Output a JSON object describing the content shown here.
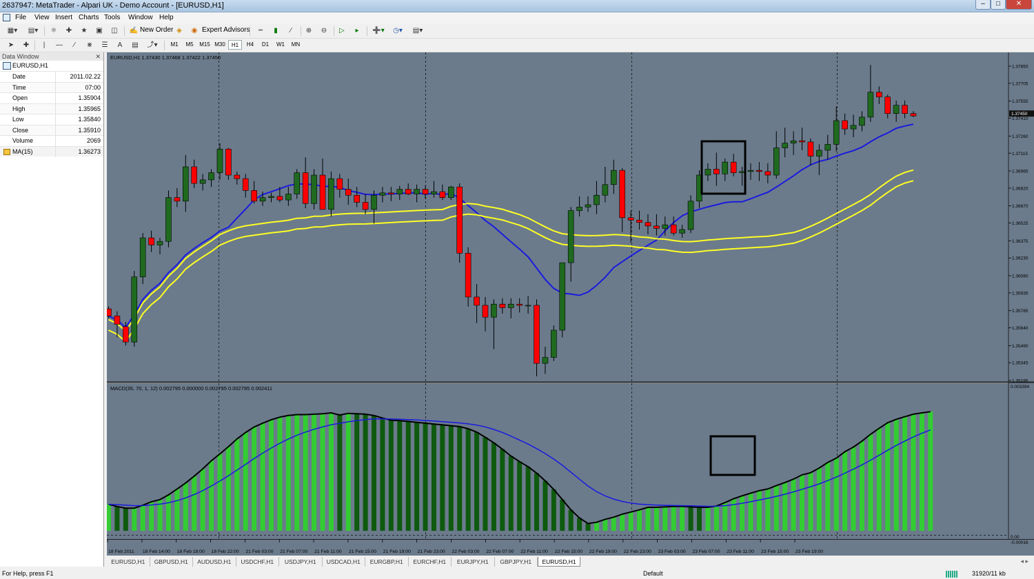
{
  "window": {
    "title": "2637947: MetaTrader - Alpari UK - Demo Account - [EURUSD,H1]"
  },
  "menu": [
    "File",
    "View",
    "Insert",
    "Charts",
    "Tools",
    "Window",
    "Help"
  ],
  "toolbar": {
    "new_order": "New Order",
    "expert_advisors": "Expert Advisors"
  },
  "timeframes": [
    "M1",
    "M5",
    "M15",
    "M30",
    "H1",
    "H4",
    "D1",
    "W1",
    "MN"
  ],
  "active_timeframe": "H1",
  "data_window": {
    "title": "Data Window",
    "symbol": "EURUSD,H1",
    "rows": [
      {
        "label": "Date",
        "value": "2011.02.22"
      },
      {
        "label": "Time",
        "value": "07:00"
      },
      {
        "label": "Open",
        "value": "1.35904"
      },
      {
        "label": "High",
        "value": "1.35965"
      },
      {
        "label": "Low",
        "value": "1.35840"
      },
      {
        "label": "Close",
        "value": "1.35910"
      },
      {
        "label": "Volume",
        "value": "2069"
      },
      {
        "label": "MA(15)",
        "value": "1.36273"
      }
    ]
  },
  "chart": {
    "header": "EURUSD,H1  1.37430 1.37468 1.37422 1.37450",
    "macd_header": "MACD(35, 70, 1, 12) 0.002795 0.000000 0.002795 0.002795 0.002411",
    "price_axis_labels": [
      "1.37850",
      "1.37705",
      "1.37555",
      "1.37410",
      "1.37260",
      "1.37115",
      "1.36965",
      "1.36820",
      "1.36670",
      "1.36525",
      "1.36375",
      "1.36230",
      "1.36080",
      "1.35935",
      "1.35785",
      "1.35640",
      "1.35490",
      "1.35345",
      "1.35195"
    ],
    "current_price": "1.37450",
    "macd_axis_labels": [
      "0.003394",
      "0.00",
      "-0.00016"
    ],
    "time_labels": [
      "18 Feb 2011",
      "18 Feb 14:00",
      "18 Feb 18:00",
      "18 Feb 22:00",
      "21 Feb 03:00",
      "21 Feb 07:00",
      "21 Feb 11:00",
      "21 Feb 15:00",
      "21 Feb 19:00",
      "21 Feb 23:00",
      "22 Feb 03:00",
      "22 Feb 07:00",
      "22 Feb 11:00",
      "22 Feb 15:00",
      "22 Feb 19:00",
      "22 Feb 23:00",
      "23 Feb 03:00",
      "23 Feb 07:00",
      "23 Feb 11:00",
      "23 Feb 15:00",
      "23 Feb 19:00"
    ],
    "colors": {
      "background": "#6b7b8c",
      "bull": "#1f6a1f",
      "bear": "#ff0000",
      "ma_blue": "#1a1adf",
      "ma_yellow": "#ffff22",
      "macd_light": "#33cc33",
      "macd_dark": "#0e5a0e"
    }
  },
  "chart_data": {
    "type": "candlestick",
    "ohlc": [
      [
        1.358,
        1.3582,
        1.3572,
        1.3574
      ],
      [
        1.3574,
        1.3578,
        1.3556,
        1.3567
      ],
      [
        1.3565,
        1.3569,
        1.3549,
        1.3552
      ],
      [
        1.3552,
        1.3612,
        1.3548,
        1.3607
      ],
      [
        1.3607,
        1.3644,
        1.3601,
        1.364
      ],
      [
        1.364,
        1.3646,
        1.3628,
        1.3634
      ],
      [
        1.3634,
        1.364,
        1.3626,
        1.3637
      ],
      [
        1.3637,
        1.368,
        1.3632,
        1.3674
      ],
      [
        1.3674,
        1.3682,
        1.3666,
        1.3671
      ],
      [
        1.3671,
        1.371,
        1.3662,
        1.37
      ],
      [
        1.37,
        1.3706,
        1.3682,
        1.3686
      ],
      [
        1.3686,
        1.3694,
        1.368,
        1.3689
      ],
      [
        1.3689,
        1.3698,
        1.3683,
        1.3695
      ],
      [
        1.3695,
        1.372,
        1.3689,
        1.3715
      ],
      [
        1.3715,
        1.3716,
        1.3689,
        1.3693
      ],
      [
        1.3693,
        1.3696,
        1.3685,
        1.369
      ],
      [
        1.369,
        1.3694,
        1.3674,
        1.368
      ],
      [
        1.368,
        1.3688,
        1.3669,
        1.3671
      ],
      [
        1.3671,
        1.3679,
        1.3667,
        1.3674
      ],
      [
        1.3674,
        1.3678,
        1.367,
        1.3675
      ],
      [
        1.3675,
        1.3683,
        1.367,
        1.3672
      ],
      [
        1.3672,
        1.3683,
        1.3667,
        1.3677
      ],
      [
        1.3677,
        1.3698,
        1.3673,
        1.3695
      ],
      [
        1.3695,
        1.3708,
        1.3665,
        1.3669
      ],
      [
        1.3669,
        1.3698,
        1.3664,
        1.3693
      ],
      [
        1.3693,
        1.3707,
        1.3682,
        1.3664
      ],
      [
        1.3664,
        1.3696,
        1.3658,
        1.369
      ],
      [
        1.369,
        1.3694,
        1.3674,
        1.3681
      ],
      [
        1.3681,
        1.369,
        1.3668,
        1.3676
      ],
      [
        1.3676,
        1.3683,
        1.3666,
        1.367
      ],
      [
        1.367,
        1.3677,
        1.366,
        1.3664
      ],
      [
        1.3664,
        1.368,
        1.3652,
        1.3676
      ],
      [
        1.3676,
        1.3683,
        1.367,
        1.3678
      ],
      [
        1.3678,
        1.3683,
        1.3671,
        1.3677
      ],
      [
        1.3677,
        1.3684,
        1.3672,
        1.3681
      ],
      [
        1.3681,
        1.3686,
        1.3676,
        1.3677
      ],
      [
        1.3677,
        1.3685,
        1.367,
        1.3681
      ],
      [
        1.3681,
        1.3684,
        1.3673,
        1.3677
      ],
      [
        1.3677,
        1.3688,
        1.3674,
        1.3679
      ],
      [
        1.3679,
        1.3685,
        1.3672,
        1.3674
      ],
      [
        1.3674,
        1.3684,
        1.3672,
        1.3683
      ],
      [
        1.3683,
        1.3686,
        1.3619,
        1.3627
      ],
      [
        1.3627,
        1.3632,
        1.3582,
        1.359
      ],
      [
        1.359,
        1.3601,
        1.3568,
        1.3583
      ],
      [
        1.3583,
        1.359,
        1.3561,
        1.3573
      ],
      [
        1.3573,
        1.3588,
        1.3546,
        1.3584
      ],
      [
        1.3584,
        1.3589,
        1.3576,
        1.3581
      ],
      [
        1.3581,
        1.3589,
        1.3572,
        1.3584
      ],
      [
        1.3584,
        1.3589,
        1.3577,
        1.3583
      ],
      [
        1.3583,
        1.3591,
        1.3576,
        1.3583
      ],
      [
        1.3583,
        1.3588,
        1.3523,
        1.3534
      ],
      [
        1.3534,
        1.3548,
        1.3525,
        1.3539
      ],
      [
        1.3539,
        1.3566,
        1.3536,
        1.3562
      ],
      [
        1.3562,
        1.3612,
        1.3556,
        1.3619
      ],
      [
        1.3619,
        1.3666,
        1.3603,
        1.3663
      ],
      [
        1.3663,
        1.3675,
        1.3658,
        1.3666
      ],
      [
        1.3666,
        1.3675,
        1.3662,
        1.3668
      ],
      [
        1.3668,
        1.3688,
        1.366,
        1.3676
      ],
      [
        1.3676,
        1.37,
        1.367,
        1.3685
      ],
      [
        1.3685,
        1.3706,
        1.3677,
        1.3697
      ],
      [
        1.3697,
        1.3699,
        1.3645,
        1.3657
      ],
      [
        1.3657,
        1.3663,
        1.3636,
        1.3655
      ],
      [
        1.3655,
        1.3663,
        1.3647,
        1.3653
      ],
      [
        1.3653,
        1.366,
        1.3643,
        1.365
      ],
      [
        1.365,
        1.366,
        1.3642,
        1.3648
      ],
      [
        1.3648,
        1.3658,
        1.3642,
        1.3651
      ],
      [
        1.3651,
        1.3658,
        1.3642,
        1.3644
      ],
      [
        1.3644,
        1.3651,
        1.364,
        1.3647
      ],
      [
        1.3647,
        1.3676,
        1.3644,
        1.3671
      ],
      [
        1.3671,
        1.3697,
        1.3665,
        1.3693
      ],
      [
        1.3693,
        1.3703,
        1.3688,
        1.3698
      ],
      [
        1.3698,
        1.3712,
        1.3684,
        1.3694
      ],
      [
        1.3694,
        1.3707,
        1.3688,
        1.3704
      ],
      [
        1.3704,
        1.3711,
        1.3692,
        1.3695
      ],
      [
        1.3695,
        1.37,
        1.3684,
        1.3696
      ],
      [
        1.3696,
        1.3703,
        1.3689,
        1.3697
      ],
      [
        1.3697,
        1.3704,
        1.3688,
        1.3696
      ],
      [
        1.3696,
        1.3703,
        1.3686,
        1.3693
      ],
      [
        1.3693,
        1.373,
        1.369,
        1.3716
      ],
      [
        1.3716,
        1.3733,
        1.3708,
        1.372
      ],
      [
        1.372,
        1.373,
        1.371,
        1.3722
      ],
      [
        1.3722,
        1.3733,
        1.3714,
        1.3721
      ],
      [
        1.3721,
        1.3724,
        1.3701,
        1.3709
      ],
      [
        1.3709,
        1.3719,
        1.3693,
        1.3714
      ],
      [
        1.3714,
        1.3727,
        1.3706,
        1.3719
      ],
      [
        1.3719,
        1.3751,
        1.3713,
        1.3739
      ],
      [
        1.3739,
        1.3745,
        1.3727,
        1.3732
      ],
      [
        1.3732,
        1.3744,
        1.3725,
        1.3735
      ],
      [
        1.3735,
        1.3747,
        1.373,
        1.3742
      ],
      [
        1.3742,
        1.3786,
        1.3738,
        1.3763
      ],
      [
        1.3763,
        1.3768,
        1.3753,
        1.3759
      ],
      [
        1.3759,
        1.3761,
        1.3741,
        1.3745
      ],
      [
        1.3745,
        1.3756,
        1.3738,
        1.3752
      ],
      [
        1.3752,
        1.3756,
        1.3741,
        1.3745
      ],
      [
        1.3745,
        1.3747,
        1.3742,
        1.3743
      ]
    ],
    "ylim": [
      1.35195,
      1.3792
    ],
    "macd_values": [
      0.00062,
      0.00057,
      0.00053,
      0.00053,
      0.0006,
      0.00068,
      0.00073,
      0.00084,
      0.00098,
      0.00112,
      0.00128,
      0.00145,
      0.00164,
      0.0018,
      0.00197,
      0.00215,
      0.0023,
      0.00243,
      0.00252,
      0.0026,
      0.00266,
      0.0027,
      0.00272,
      0.00272,
      0.00273,
      0.00274,
      0.00276,
      0.00271,
      0.00275,
      0.00274,
      0.00273,
      0.0027,
      0.00264,
      0.00259,
      0.00258,
      0.00256,
      0.00254,
      0.00252,
      0.0025,
      0.00248,
      0.00246,
      0.00244,
      0.00239,
      0.00231,
      0.00219,
      0.00206,
      0.00191,
      0.00175,
      0.00162,
      0.0015,
      0.00135,
      0.00117,
      0.00097,
      0.00073,
      0.00049,
      0.0003,
      0.00017,
      0.0002,
      0.00027,
      0.00032,
      0.00039,
      0.00044,
      0.00049,
      0.00055,
      0.00055,
      0.00056,
      0.00057,
      0.00057,
      0.00056,
      0.00055,
      0.00055,
      0.00058,
      0.00066,
      0.00075,
      0.00082,
      0.00088,
      0.00094,
      0.00098,
      0.00106,
      0.00113,
      0.00121,
      0.00131,
      0.00136,
      0.00147,
      0.0016,
      0.0017,
      0.00185,
      0.00196,
      0.0021,
      0.00226,
      0.0024,
      0.00253,
      0.00261,
      0.00267,
      0.00273,
      0.00276,
      0.00279
    ],
    "macd_ylim": [
      -0.00016,
      0.00339
    ]
  },
  "symbol_tabs": [
    "EURUSD,H1",
    "GBPUSD,H1",
    "AUDUSD,H1",
    "USDCHF,H1",
    "USDJPY,H1",
    "USDCAD,H1",
    "EURGBP,H1",
    "EURCHF,H1",
    "EURJPY,H1",
    "GBPJPY,H1",
    "EURUSD,H1"
  ],
  "active_tab": 10,
  "status": {
    "help": "For Help, press F1",
    "profile": "Default",
    "traffic": "31920/11 kb"
  }
}
